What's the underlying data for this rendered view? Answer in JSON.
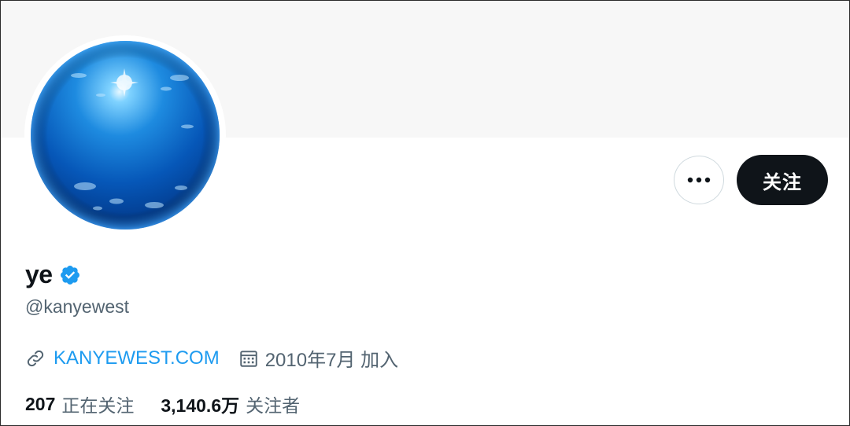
{
  "profile": {
    "name": "ye",
    "handle": "@kanyewest",
    "website": "KANYEWEST.COM",
    "joined": "2010年7月 加入",
    "verified": true,
    "verified_color": "#1d9bf0"
  },
  "actions": {
    "more_label": "•••",
    "follow_label": "关注"
  },
  "stats": {
    "following_count": "207",
    "following_label": "正在关注",
    "followers_count": "3,140.6万",
    "followers_label": "关注者"
  },
  "colors": {
    "accent": "#1d9bf0",
    "follow_button": "#0f1419",
    "muted_text": "#536471",
    "banner": "#f7f7f7"
  },
  "icons": {
    "link": "link-icon",
    "calendar": "calendar-icon",
    "verified": "verified-badge-icon",
    "more": "more-icon"
  }
}
